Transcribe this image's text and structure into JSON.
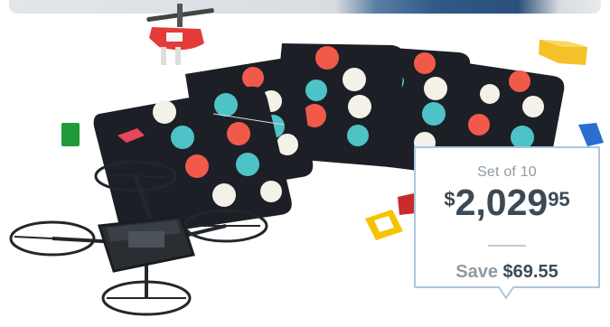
{
  "price_callout": {
    "set_label": "Set of 10",
    "currency": "$",
    "price_whole": "2,029",
    "price_cents": "95",
    "save_label": "Save",
    "save_amount": "$69.55"
  },
  "colors": {
    "callout_border": "#a9c6df",
    "price_text": "#3c4a55",
    "muted_text": "#8f9aa3",
    "mat_background": "#1d1f26"
  }
}
